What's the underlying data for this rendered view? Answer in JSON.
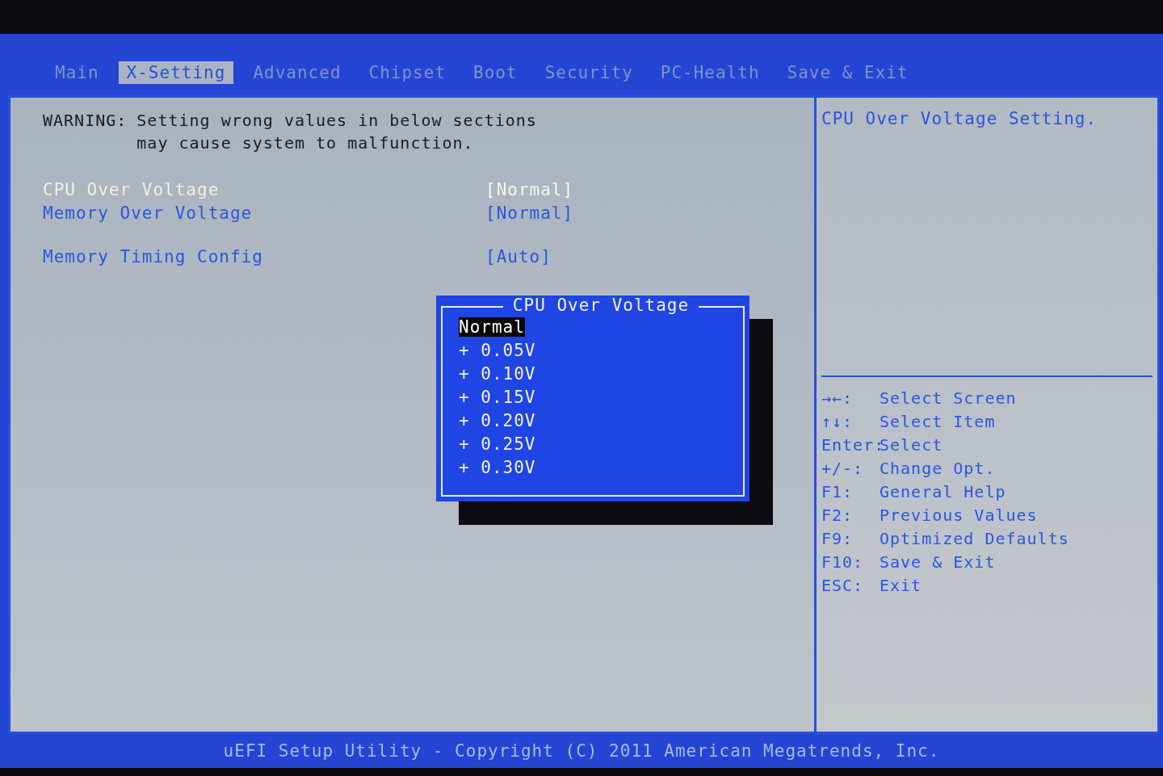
{
  "tabs": [
    {
      "label": "Main",
      "selected": false
    },
    {
      "label": "X-Setting",
      "selected": true
    },
    {
      "label": "Advanced",
      "selected": false
    },
    {
      "label": "Chipset",
      "selected": false
    },
    {
      "label": "Boot",
      "selected": false
    },
    {
      "label": "Security",
      "selected": false
    },
    {
      "label": "PC-Health",
      "selected": false
    },
    {
      "label": "Save & Exit",
      "selected": false
    }
  ],
  "warning": {
    "label": "WARNING:",
    "lines": [
      "Setting wrong values in below sections",
      "may cause system to malfunction."
    ]
  },
  "setting_groups": [
    {
      "items": [
        {
          "label": "CPU Over Voltage",
          "value": "[Normal]",
          "selected": true
        },
        {
          "label": "Memory Over Voltage",
          "value": "[Normal]",
          "selected": false
        }
      ]
    },
    {
      "items": [
        {
          "label": "Memory Timing Config",
          "value": "[Auto]",
          "selected": false
        }
      ]
    }
  ],
  "popup": {
    "title": "CPU Over Voltage",
    "options": [
      {
        "label": "Normal",
        "selected": true
      },
      {
        "label": "+ 0.05V",
        "selected": false
      },
      {
        "label": "+ 0.10V",
        "selected": false
      },
      {
        "label": "+ 0.15V",
        "selected": false
      },
      {
        "label": "+ 0.20V",
        "selected": false
      },
      {
        "label": "+ 0.25V",
        "selected": false
      },
      {
        "label": "+ 0.30V",
        "selected": false
      }
    ]
  },
  "help": "CPU Over Voltage Setting.",
  "keys": [
    {
      "key": "→←:",
      "action": "Select Screen"
    },
    {
      "key": "↑↓:",
      "action": "Select Item"
    },
    {
      "key": "Enter:",
      "action": "Select"
    },
    {
      "key": "+/-:",
      "action": "Change Opt."
    },
    {
      "key": "F1:",
      "action": "General Help"
    },
    {
      "key": "F2:",
      "action": "Previous Values"
    },
    {
      "key": "F9:",
      "action": "Optimized Defaults"
    },
    {
      "key": "F10:",
      "action": "Save & Exit"
    },
    {
      "key": "ESC:",
      "action": "Exit"
    }
  ],
  "footer": "uEFI Setup Utility - Copyright (C) 2011 American Megatrends, Inc."
}
